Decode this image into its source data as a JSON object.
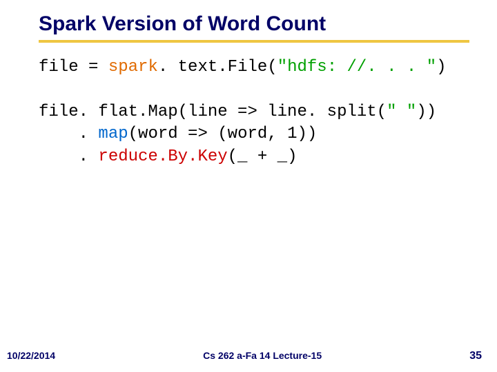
{
  "title": "Spark Version of Word Count",
  "code": {
    "l1a": "file = ",
    "l1b": "spark",
    "l1c": ". text.File",
    "l1d": "(",
    "l1e": "\"hdfs: //. . . \"",
    "l1f": ")",
    "l2": "",
    "l3a": "file. flat.Map(line => line. split(",
    "l3b": "\" \"",
    "l3c": "))",
    "l4a": "    . ",
    "l4b": "map",
    "l4c": "(word => (word, 1))",
    "l5a": "    . ",
    "l5b": "reduce.By.Key",
    "l5c": "(_ + _)"
  },
  "footer": {
    "date": "10/22/2014",
    "course": "Cs 262 a-Fa 14 Lecture-15",
    "page": "35"
  }
}
